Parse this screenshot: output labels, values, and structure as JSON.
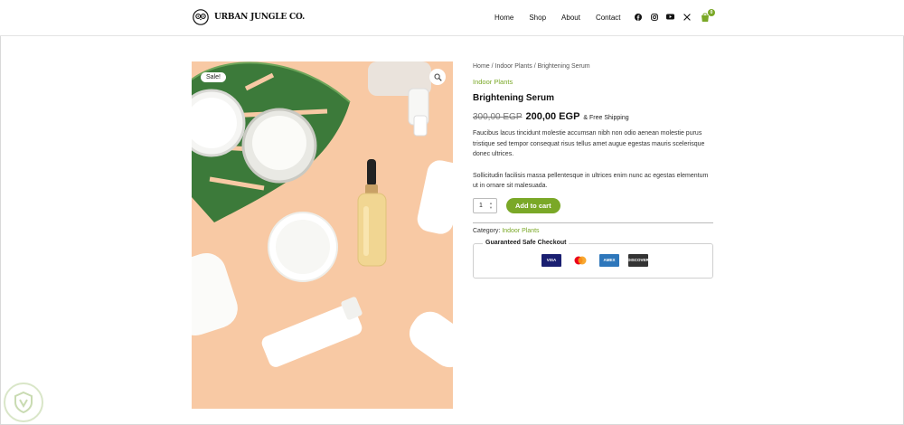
{
  "brand": {
    "name": "URBAN JUNGLE CO."
  },
  "nav": {
    "items": [
      "Home",
      "Shop",
      "About",
      "Contact"
    ]
  },
  "socials": [
    "facebook-icon",
    "instagram-icon",
    "youtube-icon",
    "x-icon"
  ],
  "cart": {
    "count": "0"
  },
  "product": {
    "sale_badge": "Sale!",
    "breadcrumb": "Home / Indoor Plants / Brightening Serum",
    "category": "Indoor Plants",
    "title": "Brightening Serum",
    "old_price": "300,00 EGP",
    "new_price": "200,00 EGP",
    "shipping": "& Free Shipping",
    "description_1": "Faucibus lacus tincidunt molestie accumsan nibh non odio aenean molestie purus tristique sed tempor consequat risus tellus amet augue egestas mauris scelerisque donec ultrices.",
    "description_2": "Sollicitudin facilisis massa pellentesque in ultrices enim nunc ac egestas elementum ut in ornare sit malesuada.",
    "quantity": "1",
    "add_to_cart": "Add to cart",
    "category_label": "Category:",
    "category_value": "Indoor Plants"
  },
  "checkout": {
    "title": "Guaranteed Safe Checkout",
    "cards": [
      {
        "name": "VISA",
        "color": "#1a1f71"
      },
      {
        "name": "",
        "color": "#ffffff"
      },
      {
        "name": "AMEX",
        "color": "#2e77bb"
      },
      {
        "name": "DISCOVER",
        "color": "#333333"
      }
    ]
  },
  "colors": {
    "accent": "#7aa827",
    "image_bg": "#f8c9a4"
  }
}
